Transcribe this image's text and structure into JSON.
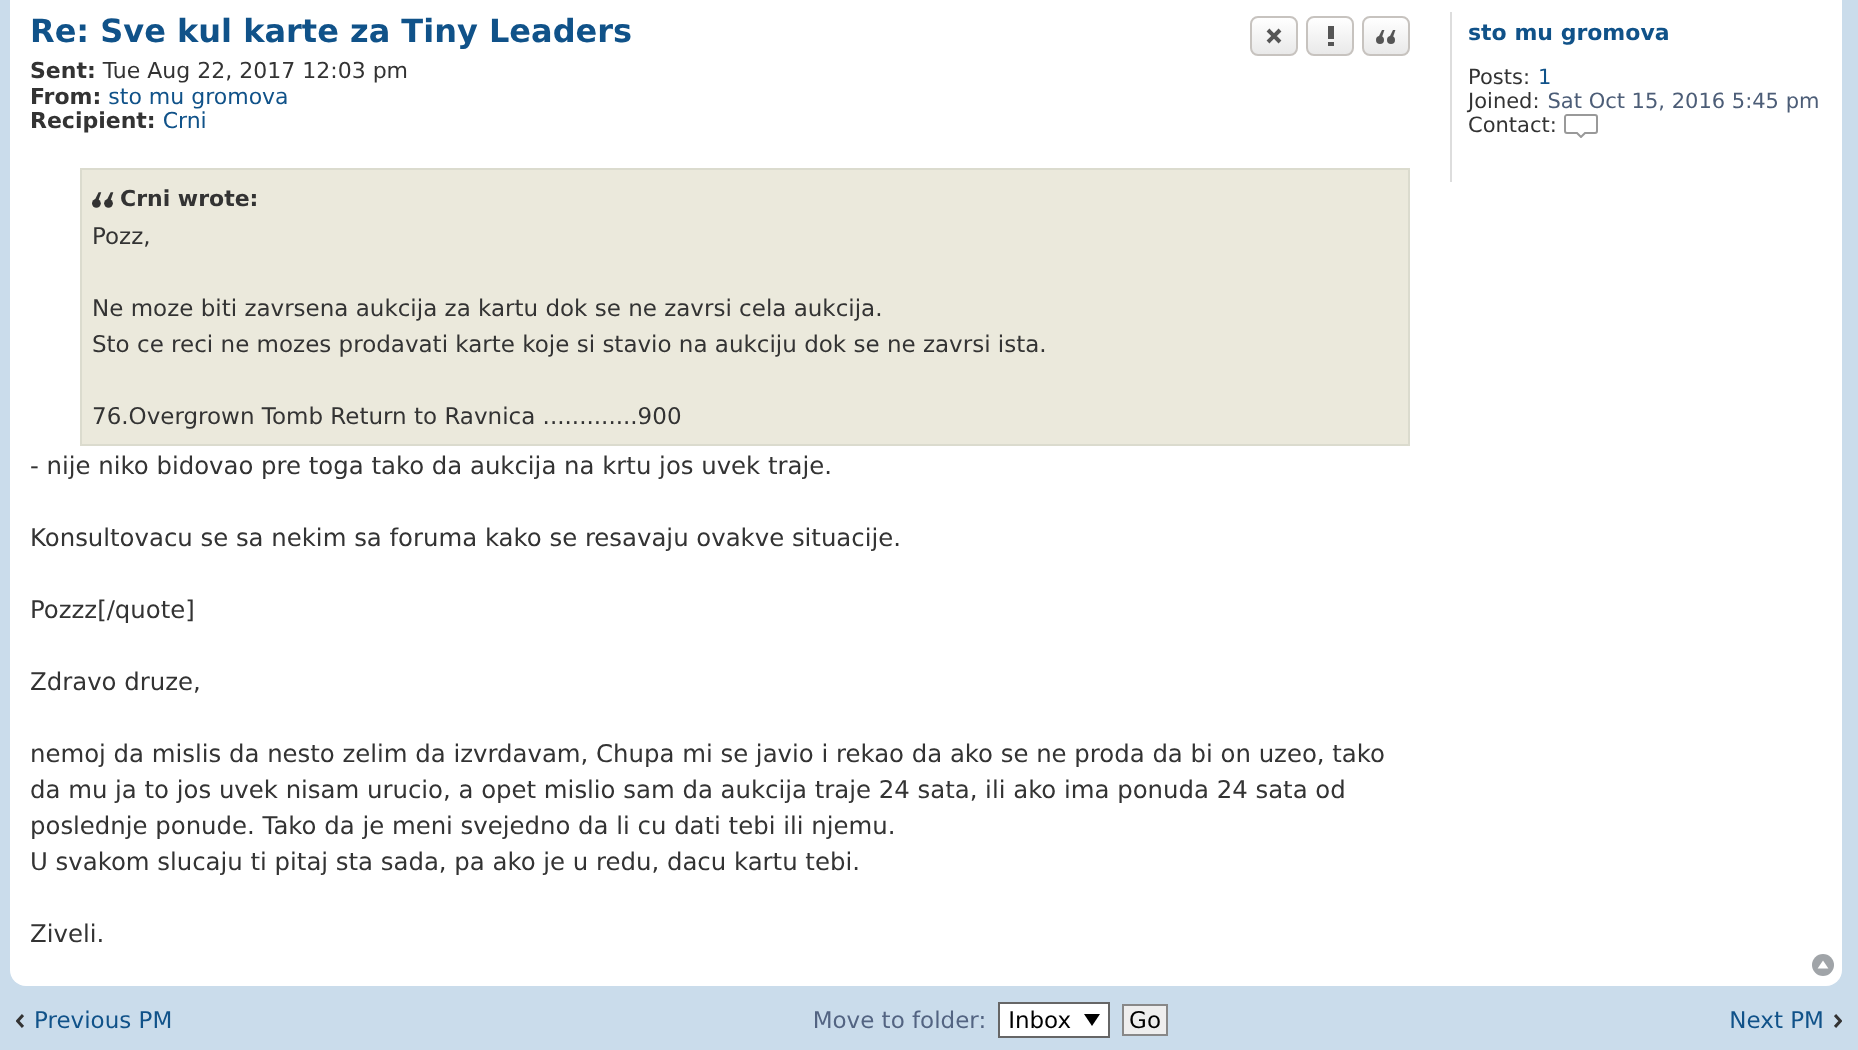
{
  "message": {
    "title": "Re: Sve kul karte za Tiny Leaders",
    "details": [
      {
        "label": "Sent:",
        "value": "Tue Aug 22, 2017 12:03 pm",
        "link": false
      },
      {
        "label": "From:",
        "value": "sto mu gromova",
        "link": true
      },
      {
        "label": "Recipient:",
        "value": "Crni",
        "link": true
      }
    ],
    "quote": {
      "author": "Crni wrote:",
      "paragraphs": [
        [
          "Pozz,"
        ],
        [
          "Ne moze biti zavrsena aukcija za kartu dok se ne zavrsi cela aukcija.",
          "Sto ce reci ne mozes prodavati karte koje si stavio na aukciju dok se ne zavrsi ista."
        ],
        [
          "76.Overgrown Tomb Return to Ravnica .............900"
        ]
      ]
    },
    "paragraphs": [
      [
        "- nije niko bidovao pre toga tako da aukcija na krtu jos uvek traje."
      ],
      [
        "Konsultovacu se sa nekim sa foruma kako se resavaju ovakve situacije."
      ],
      [
        "Pozzz[/quote]"
      ],
      [
        "Zdravo druze,"
      ],
      [
        "nemoj da mislis da nesto zelim da izvrdavam, Chupa mi se javio i rekao da ako se ne proda da bi on uzeo, tako da mu ja to jos uvek nisam urucio, a opet mislio sam da aukcija traje 24 sata, ili ako ima ponuda 24 sata od poslednje ponude. Tako da je meni svejedno da li cu dati tebi ili njemu.",
        "U svakom slucaju ti pitaj sta sada, pa ako je u redu, dacu kartu tebi."
      ],
      [
        "Ziveli."
      ]
    ]
  },
  "actions": [
    {
      "kind": "delete"
    },
    {
      "kind": "report"
    },
    {
      "kind": "quote"
    }
  ],
  "profile": {
    "name": "sto mu gromova",
    "fields": [
      {
        "label": "Posts:",
        "value": "1",
        "kind": "link"
      },
      {
        "label": "Joined:",
        "value": "Sat Oct 15, 2016 5:45 pm",
        "kind": "text"
      },
      {
        "label": "Contact:",
        "kind": "contact"
      }
    ]
  },
  "footer": {
    "previous": "Previous PM",
    "move_label": "Move to folder:",
    "folder": "Inbox",
    "go": "Go",
    "next": "Next PM"
  }
}
